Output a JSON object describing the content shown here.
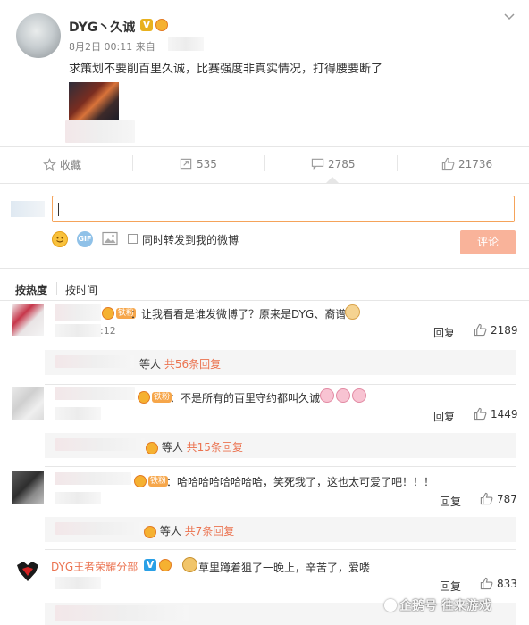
{
  "post": {
    "author": "DYG丶久诚",
    "date": "8月2日 00:11",
    "source_prefix": "来自",
    "text": "求策划不要削百里久诚，比赛强度非真实情况，打得腰要断了"
  },
  "actions": {
    "favorite": "收藏",
    "repost_count": "535",
    "comment_count": "2785",
    "like_count": "21736"
  },
  "compose": {
    "input_value": "",
    "sync_label": "同时转发到我的微博",
    "submit_label": "评论"
  },
  "sort": {
    "hot": "按热度",
    "time": "按时间"
  },
  "comments": [
    {
      "badge": "铁粉",
      "text": "：让我看看是谁发微博了？原来是DYG、裔谱",
      "time": ":12",
      "reply": "回复",
      "likes": "2189",
      "sub_suffix": "等人",
      "sub_count": "共56条回复"
    },
    {
      "badge": "铁粉",
      "text": "：不是所有的百里守约都叫久诚",
      "reply": "回复",
      "likes": "1449",
      "sub_suffix": "等人",
      "sub_count": "共15条回复"
    },
    {
      "badge": "铁粉",
      "text": "：哈哈哈哈哈哈哈哈，笑死我了，这也太可爱了吧！！！",
      "reply": "回复",
      "likes": "787",
      "sub_suffix": "等人",
      "sub_count": "共7条回复"
    },
    {
      "author": "DYG王者荣耀分部",
      "text": "草里蹲着狙了一晚上，辛苦了，爱喽",
      "reply": "回复",
      "likes": "833"
    }
  ],
  "watermark": "企鹅号 往来游戏",
  "colors": {
    "accent": "#eb7350",
    "link": "#eb7350",
    "submit_bg": "#f9b39a",
    "divider": "#e6e6e6"
  }
}
